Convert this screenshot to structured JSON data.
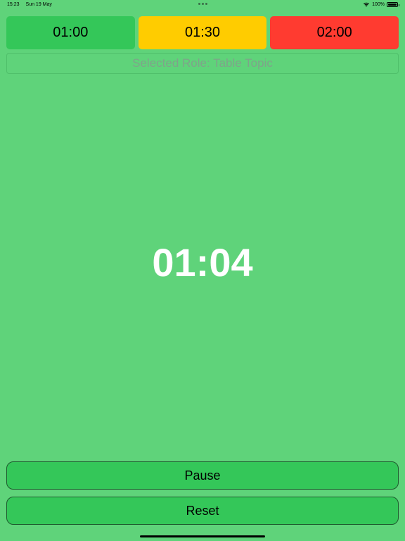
{
  "status_bar": {
    "time": "15:23",
    "date": "Sun 19 May",
    "battery_text": "100%",
    "battery_level": 1.0
  },
  "time_buttons": [
    {
      "label": "01:00",
      "color": "#34c759"
    },
    {
      "label": "01:30",
      "color": "#ffcc00"
    },
    {
      "label": "02:00",
      "color": "#ff3b30"
    }
  ],
  "role": {
    "text": "Selected Role: Table Topic"
  },
  "timer": {
    "display": "01:04"
  },
  "actions": {
    "pause_label": "Pause",
    "reset_label": "Reset",
    "button_color": "#34c759"
  },
  "theme": {
    "background": "#5fd37a"
  }
}
